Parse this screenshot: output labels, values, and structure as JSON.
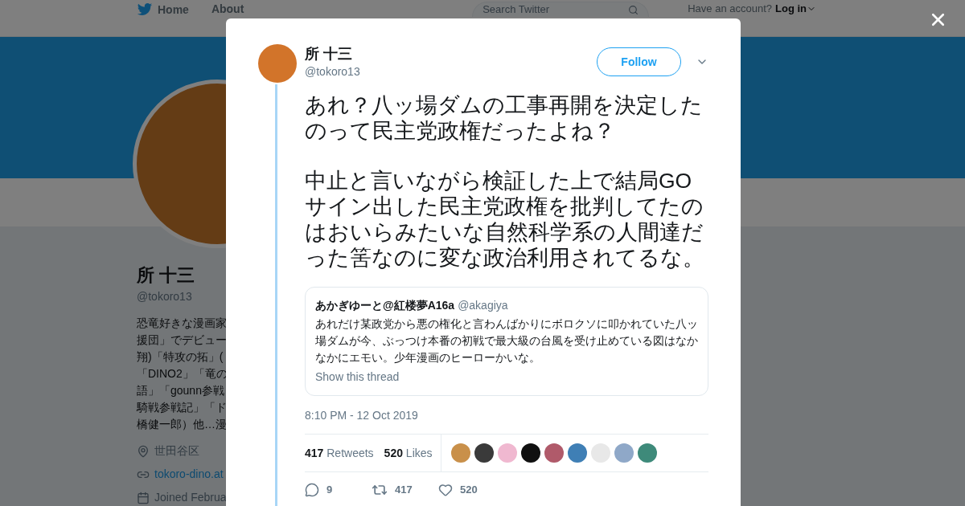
{
  "nav": {
    "items": [
      {
        "label": "Home",
        "kind": "bird"
      },
      {
        "label": "About",
        "kind": "plain"
      }
    ],
    "search_placeholder": "Search Twitter",
    "account_prompt": "Have an account?",
    "login": "Log in"
  },
  "profile": {
    "name": "所 十三",
    "handle": "@tokoro13",
    "bio_lines": [
      "恐竜好きな漫画家",
      "援団」でデビュー",
      "翔)「特攻の拓」(",
      "「DINO2」「竜の",
      "語」「gounn参戦",
      "騎戦参戦記」「ド",
      "橋健一郎）他…漫"
    ],
    "location": "世田谷区",
    "website": "tokoro-dino.at",
    "joined": "Joined Februa"
  },
  "tweet": {
    "name": "所 十三",
    "handle": "@tokoro13",
    "follow": "Follow",
    "paragraphs": [
      "あれ？八ッ場ダムの工事再開を決定したのって民主党政権だったよね？",
      "中止と言いながら検証した上で結局GOサイン出した民主党政権を批判してたのはおいらみたいな自然科学系の人間達だった筈なのに変な政治利用されてるな。"
    ],
    "quote": {
      "name": "あかぎゆーと@紅楼夢A16a",
      "handle": "@akagiya",
      "text": "あれだけ某政党から悪の権化と言わんばかりにボロクソに叩かれていた八ッ場ダムが今、ぶっつけ本番の初戦で最大級の台風を受け止めている図はなかなかにエモい。少年漫画のヒーローかいな。",
      "show_thread": "Show this thread"
    },
    "timestamp": "8:10 PM - 12 Oct 2019",
    "stats": [
      {
        "count": "417",
        "label": "Retweets"
      },
      {
        "count": "520",
        "label": "Likes"
      }
    ],
    "actions": [
      {
        "kind": "reply",
        "count": "9"
      },
      {
        "kind": "retweet",
        "count": "417"
      },
      {
        "kind": "like",
        "count": "520"
      }
    ]
  }
}
